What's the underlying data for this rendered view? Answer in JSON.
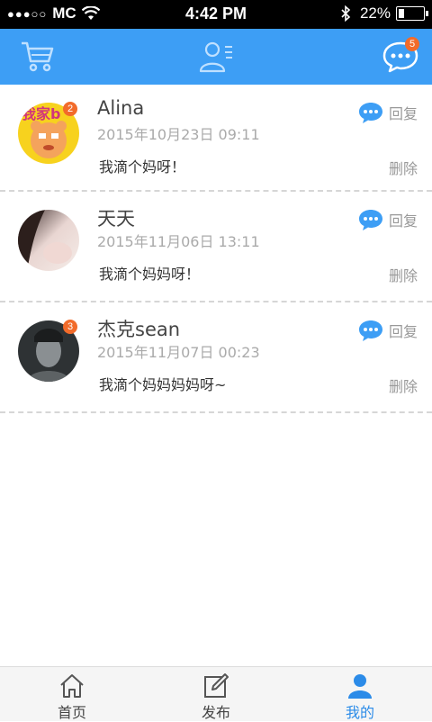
{
  "status_bar": {
    "signal_dots": "●●●○○",
    "carrier": "MC",
    "time": "4:42 PM",
    "battery": "22%",
    "battery_level": 0.22
  },
  "topbar": {
    "icons": [
      "cart-icon",
      "contact-icon",
      "chat-icon"
    ],
    "chat_badge": "5"
  },
  "messages": [
    {
      "name": "Alina",
      "time": "2015年10月23日 09:11",
      "text": "我滴个妈呀！",
      "badge": "2",
      "reply_label": "回复",
      "delete_label": "删除"
    },
    {
      "name": "天天",
      "time": "2015年11月06日 13:11",
      "text": "我滴个妈妈呀！",
      "badge": "",
      "reply_label": "回复",
      "delete_label": "删除"
    },
    {
      "name": "杰克sean",
      "time": "2015年11月07日 00:23",
      "text": "我滴个妈妈妈妈呀~",
      "badge": "3",
      "reply_label": "回复",
      "delete_label": "删除"
    }
  ],
  "bottom_nav": [
    {
      "label": "首页",
      "icon": "home-icon"
    },
    {
      "label": "发布",
      "icon": "edit-icon"
    },
    {
      "label": "我的",
      "icon": "user-icon",
      "active": true
    }
  ],
  "colors": {
    "primary": "#3d9ef5",
    "badge": "#f26b2a",
    "active_nav": "#2b8be8"
  }
}
